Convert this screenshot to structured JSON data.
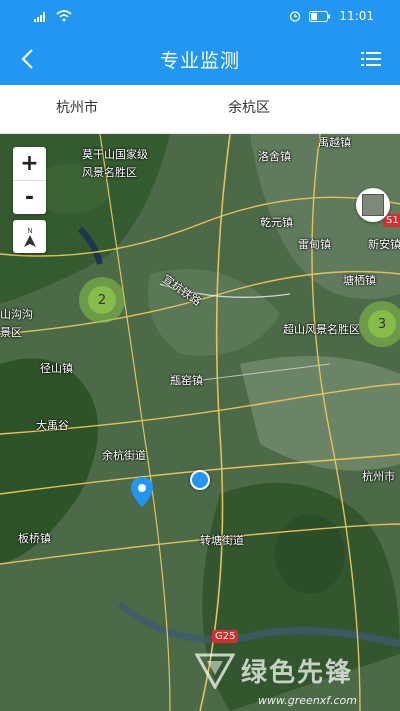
{
  "status_bar": {
    "time": "11:01"
  },
  "nav": {
    "title": "专业监测"
  },
  "region": {
    "city": "杭州市",
    "district": "余杭区"
  },
  "map": {
    "zoom_in": "+",
    "zoom_out": "-",
    "compass_label": "N",
    "clusters": [
      {
        "count": "2"
      },
      {
        "count": "3"
      }
    ],
    "places": [
      "莫干山国家级",
      "风景名胜区",
      "洛舍镇",
      "乾元镇",
      "雷甸镇",
      "新安镇",
      "塘栖镇",
      "超山风景名胜区",
      "山沟沟",
      "景区",
      "径山镇",
      "瓶窑镇",
      "大禹谷",
      "余杭街道",
      "杭州市",
      "板桥镇",
      "转塘街道",
      "宣杭铁路",
      "禹越镇"
    ],
    "road_shields": [
      "S1",
      "G25"
    ],
    "watermark": "绿色先锋",
    "watermark_url": "www.greenxf.com"
  }
}
